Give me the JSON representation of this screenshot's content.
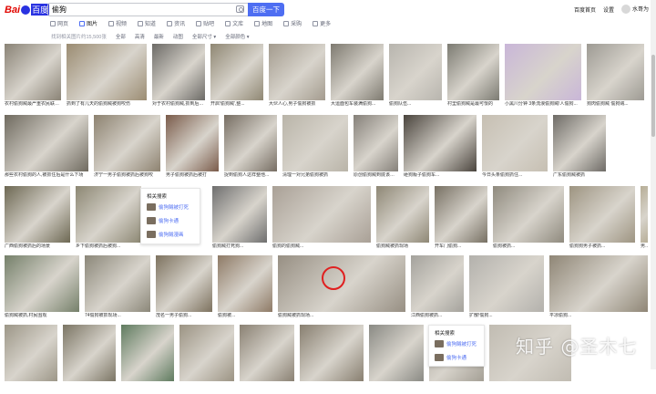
{
  "header": {
    "logo_text_left": "Bai",
    "logo_text_right": "百度",
    "search_query": "偷狗",
    "search_button": "百度一下",
    "home_link": "百度首页",
    "settings_link": "设置",
    "username": "水哥为"
  },
  "tabs": [
    {
      "label": "网页",
      "active": false
    },
    {
      "label": "图片",
      "active": true
    },
    {
      "label": "视频",
      "active": false
    },
    {
      "label": "知道",
      "active": false
    },
    {
      "label": "资讯",
      "active": false
    },
    {
      "label": "贴吧",
      "active": false
    },
    {
      "label": "文库",
      "active": false
    },
    {
      "label": "地图",
      "active": false
    },
    {
      "label": "采购",
      "active": false
    },
    {
      "label": "更多",
      "active": false
    }
  ],
  "filters": {
    "result_count": "找到相关图片约15,500张",
    "items": [
      "全部",
      "高清",
      "最新",
      "动图",
      "全部尺寸 ▾",
      "全部颜色 ▾"
    ]
  },
  "rows": [
    {
      "items": [
        {
          "caption": "农村偷狗贼最严重农民联合抓捕偷狗贼处理",
          "color": "#8a8376"
        },
        {
          "caption": "抓到了有几天的偷狗贼被狗咬伤",
          "color": "#9b8c72"
        },
        {
          "caption": "对于农村偷狗贼,抓到后直接打",
          "color": "#6c6a66"
        },
        {
          "caption": "开启'偷狗贼',整...",
          "color": "#8f8773"
        },
        {
          "caption": "大伙人心,男子偷狗被抓",
          "color": "#a39b8e"
        },
        {
          "caption": "大运面包车装满偷狗...",
          "color": "#7e7a70"
        },
        {
          "caption": "偷狗队伍...",
          "color": "#b8b5ae"
        },
        {
          "caption": "村里偷狗贼是最可恨的",
          "color": "#7c7b72"
        },
        {
          "caption": "小黑川分钟 3条流浪偷狗贼!人偷狗...",
          "color": "#c9b6d8"
        },
        {
          "caption": "狗肉偷狗贼 偷狗贼...",
          "color": "#9d9a93"
        }
      ]
    },
    {
      "items": [
        {
          "caption": "那些农村偷狗的人,被抓住后是什么下场",
          "color": "#6f6a5f"
        },
        {
          "caption": "济宁一男子偷狗被抓后被狗咬",
          "color": "#8d8270"
        },
        {
          "caption": "男子偷狗被抓后被打",
          "color": "#7a5b4a"
        },
        {
          "caption": "捉到偷狗人这样整他...",
          "color": "#766d62"
        },
        {
          "caption": "清理一对兄弟偷狗被抓",
          "color": "#b9b4a8"
        },
        {
          "caption": "原创偷狗贼到底该打不该打",
          "color": "#858079"
        },
        {
          "caption": "砸狗贩子偷狗车...",
          "color": "#4a443d"
        },
        {
          "caption": "今日头条偷狗抓住...",
          "color": "#c6bfb2"
        },
        {
          "caption": "广东偷狗贼被抓",
          "color": "#6e6b66"
        }
      ]
    },
    {
      "items": [
        {
          "caption": "广西偷狗被抓后的场景",
          "color": "#6d6853"
        },
        {
          "caption": "乡下偷狗被抓后被狗...",
          "color": "#8c8773"
        },
        {
          "caption": "偷狗贼打死狗...",
          "color": "#6e6e6e"
        },
        {
          "caption": "偷狗的偷狗贼...",
          "color": "#a9a096"
        },
        {
          "caption": "偷狗贼被抓现场",
          "color": "#8e8775"
        },
        {
          "caption": "开车门偷狗...",
          "color": "#777063"
        },
        {
          "caption": "偷狗被抓...",
          "color": "#8f8a7e"
        },
        {
          "caption": "偷狗狗男子被抓...",
          "color": "#9d9481"
        },
        {
          "caption": "男子偷狗被抓后...",
          "color": "#b7ae97"
        }
      ]
    },
    {
      "items": [
        {
          "caption": "偷狗贼被抓,村民围观",
          "color": "#75806a"
        },
        {
          "caption": "74偷狗被抓现场...",
          "color": "#8b8779"
        },
        {
          "caption": "茂名一男子偷狗...",
          "color": "#7d725f"
        },
        {
          "caption": "偷狗被...",
          "color": "#8e7a66"
        },
        {
          "caption": "偷狗贼被抓现场...",
          "color": "#978f83"
        },
        {
          "caption": "江西偷狗被抓...",
          "color": "#a4a29c"
        },
        {
          "caption": "扩散!偷狗...",
          "color": "#b3b1ac"
        },
        {
          "caption": "平凉偷狗...",
          "color": "#8f8676"
        }
      ]
    },
    {
      "items": [
        {
          "caption": "",
          "color": "#9c9687"
        },
        {
          "caption": "",
          "color": "#7b7564"
        },
        {
          "caption": "",
          "color": "#5f7b5f"
        },
        {
          "caption": "",
          "color": "#9b9383"
        },
        {
          "caption": "",
          "color": "#8a8173"
        },
        {
          "caption": "",
          "color": "#887f70"
        },
        {
          "caption": "",
          "color": "#8a8a84"
        },
        {
          "caption": "",
          "color": "#a49f95"
        },
        {
          "caption": "",
          "color": "#c1bcb2"
        }
      ]
    }
  ],
  "related_panel_1": {
    "title": "相关搜索",
    "items": [
      "偷狗贼被打死",
      "偷狗卡通",
      "偷狗贼漫画"
    ]
  },
  "related_panel_2": {
    "title": "相关搜索",
    "items": [
      "偷狗贼被打死",
      "偷狗卡通"
    ]
  },
  "watermark": "知乎 @圣木七"
}
